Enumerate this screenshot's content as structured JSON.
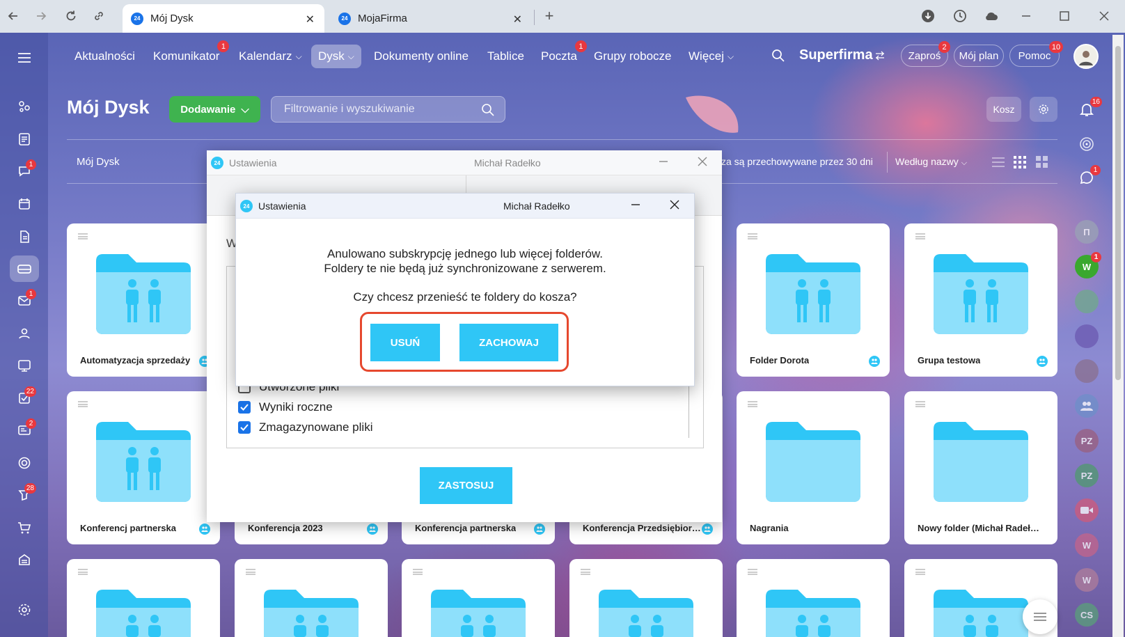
{
  "browser": {
    "tabs": [
      {
        "title": "Mój Dysk",
        "favicon": "24"
      },
      {
        "title": "MojaFirma",
        "favicon": "24"
      }
    ]
  },
  "topnav": {
    "items": [
      {
        "label": "Aktualności",
        "badge": ""
      },
      {
        "label": "Komunikator",
        "badge": "1"
      },
      {
        "label": "Kalendarz",
        "badge": ""
      },
      {
        "label": "Dysk",
        "badge": ""
      },
      {
        "label": "Dokumenty online",
        "badge": ""
      },
      {
        "label": "Tablice",
        "badge": ""
      },
      {
        "label": "Poczta",
        "badge": "1"
      },
      {
        "label": "Grupy robocze",
        "badge": ""
      },
      {
        "label": "Więcej",
        "badge": ""
      }
    ],
    "company": "Superfirma",
    "invite": {
      "label": "Zaproś",
      "badge": "2"
    },
    "plan": "Mój plan",
    "help": {
      "label": "Pomoc",
      "badge": "10"
    }
  },
  "sidebar": {
    "badges": {
      "chat": "1",
      "mail": "1",
      "tasks": "22",
      "projects": "2",
      "crm": "28"
    }
  },
  "rightbar": {
    "notifications_badge": "16",
    "messages_badge": "1",
    "avatars": [
      {
        "initials": "Π",
        "color": "#9aa3b5",
        "badge": ""
      },
      {
        "initials": "W",
        "color": "#3aa82e",
        "badge": "1"
      },
      {
        "initials": "",
        "color": "#6fa98a",
        "badge": ""
      },
      {
        "initials": "",
        "color": "#6b58b0",
        "badge": ""
      },
      {
        "initials": "",
        "color": "#8a6f8e",
        "badge": ""
      },
      {
        "initials": "",
        "color": "#6e8fc9",
        "badge": ""
      },
      {
        "initials": "PZ",
        "color": "#9a5f7e",
        "badge": ""
      },
      {
        "initials": "PZ",
        "color": "#4f9a6e",
        "badge": ""
      },
      {
        "initials": "",
        "color": "#d05a7a",
        "badge": ""
      },
      {
        "initials": "W",
        "color": "#c4648a",
        "badge": ""
      },
      {
        "initials": "W",
        "color": "#b07d9a",
        "badge": ""
      },
      {
        "initials": "CS",
        "color": "#5aa07a",
        "badge": ""
      }
    ]
  },
  "page": {
    "title": "Mój Dysk",
    "add_button": "Dodawanie",
    "filter_placeholder": "Filtrowanie i wyszukiwanie",
    "trash_button": "Kosz",
    "breadcrumb": "Mój Dysk",
    "trash_note": "za są przechowywane przez 30 dni",
    "sort": "Według nazwy"
  },
  "folders": {
    "row1": [
      {
        "name": "Automatyzacja sprzedaży",
        "shared": true,
        "people": true
      },
      {
        "name": "Folder Dorota",
        "shared": true,
        "people": true
      },
      {
        "name": "Grupa testowa",
        "shared": true,
        "people": true
      }
    ],
    "row2": [
      {
        "name": "Konferencj partnerska",
        "shared": true,
        "people": true
      },
      {
        "name": "Konferencja 2023",
        "shared": true,
        "people": true
      },
      {
        "name": "Konferencja partnerska",
        "shared": true,
        "people": true
      },
      {
        "name": "Konferencja Przedsiębiorców",
        "shared": true,
        "people": true
      },
      {
        "name": "Nagrania",
        "shared": false,
        "people": false
      },
      {
        "name": "Nowy folder (Michał Radełko)",
        "shared": false,
        "people": false
      }
    ]
  },
  "settings_window": {
    "title": "Ustawienia",
    "user": "Michał Radełko",
    "heading_letter": "W",
    "checkboxes": [
      {
        "label": "Utworzone pliki",
        "checked": false
      },
      {
        "label": "Wyniki roczne",
        "checked": true
      },
      {
        "label": "Zmagazynowane pliki",
        "checked": true
      }
    ],
    "apply_button": "ZASTOSUJ"
  },
  "dialog": {
    "title": "Ustawienia",
    "user": "Michał Radełko",
    "line1": "Anulowano subskrypcję jednego lub więcej folderów.",
    "line2": "Foldery te nie będą już synchronizowane z serwerem.",
    "question": "Czy chcesz przenieść te foldery do kosza?",
    "delete_button": "USUŃ",
    "keep_button": "ZACHOWAJ"
  },
  "colors": {
    "accent": "#2fc6f6",
    "green": "#3fb34f",
    "badge": "#e9383f",
    "highlight": "#e6482e",
    "folder": "#2fc6f6"
  }
}
